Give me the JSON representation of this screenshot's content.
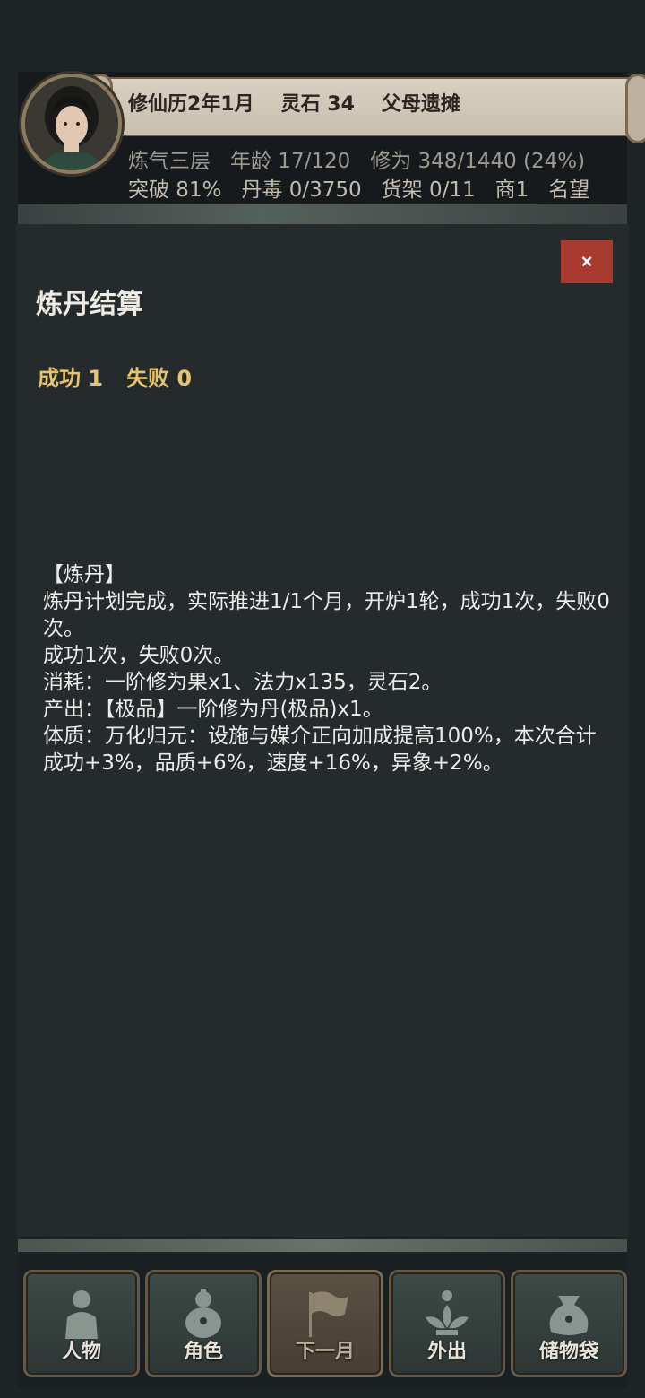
{
  "header": {
    "calendar": "修仙历2年1月",
    "spirit_stones": "灵石 34",
    "event": "父母遗摊",
    "realm": "炼气三层",
    "age": "年龄 17/120",
    "cultivation": "修为 348/1440 (24%)",
    "breakthrough": "突破 81%",
    "pill_toxicity": "丹毒 0/3750",
    "shelf": "货架 0/11",
    "merchant": "商1",
    "reputation": "名望"
  },
  "modal": {
    "close_label": "×",
    "title": "炼丹结算",
    "success": "成功 1",
    "failure": "失败 0",
    "log_lines": [
      "【炼丹】",
      "炼丹计划完成，实际推进1/1个月，开炉1轮，成功1次，失败0次。",
      "成功1次，失败0次。",
      "消耗：一阶修为果x1、法力x135，灵石2。",
      "产出：【极品】一阶修为丹(极品)x1。",
      "体质：万化归元：设施与媒介正向加成提高100%，本次合计成功+3%，品质+6%，速度+16%，异象+2%。"
    ]
  },
  "nav": {
    "items": [
      {
        "label": "人物",
        "icon": "person-icon"
      },
      {
        "label": "角色",
        "icon": "gourd-icon"
      },
      {
        "label": "下一月",
        "icon": "flag-icon"
      },
      {
        "label": "外出",
        "icon": "lotus-icon"
      },
      {
        "label": "储物袋",
        "icon": "bag-icon"
      }
    ]
  },
  "colors": {
    "accent_gold": "#e6c36c",
    "close_red": "#a8392f",
    "panel": "#252b2d"
  }
}
